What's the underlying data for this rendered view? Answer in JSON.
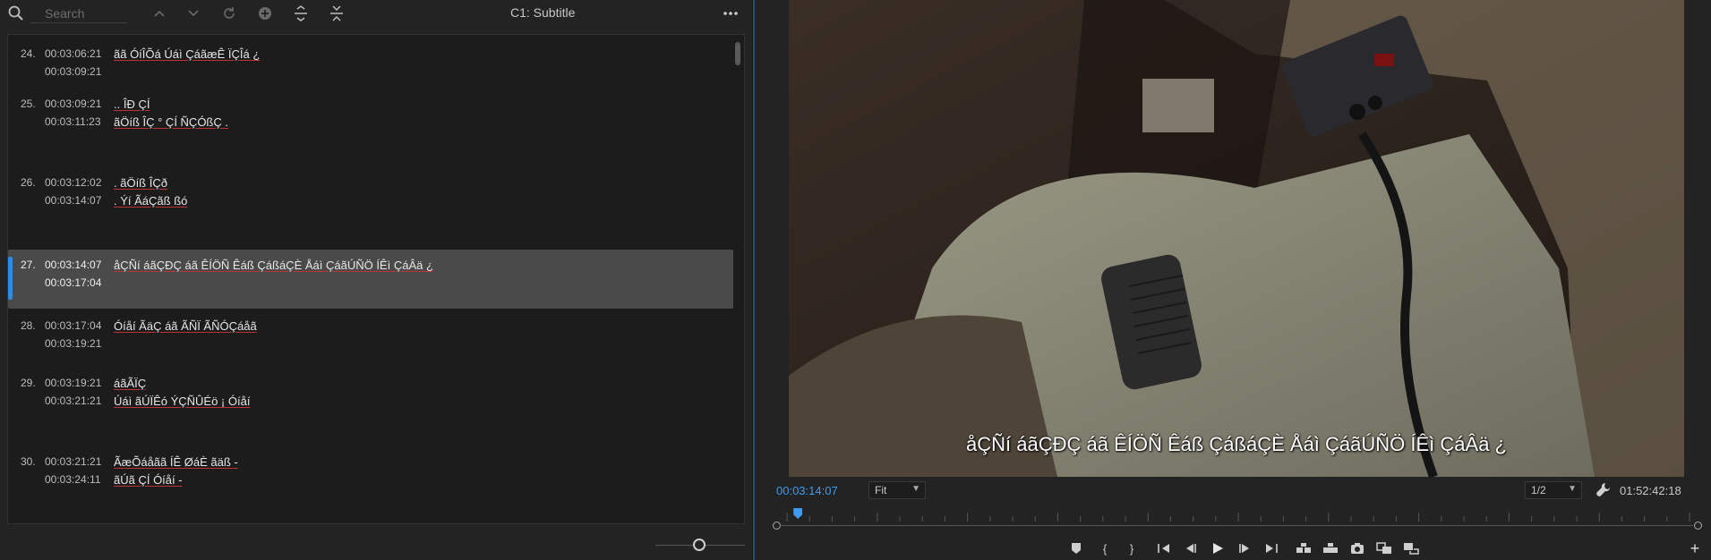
{
  "captions_panel": {
    "search": {
      "placeholder": "Search"
    },
    "title": "C1: Subtitle",
    "rows": [
      {
        "num": "24.",
        "in": "00:03:06:21",
        "out": "00:03:09:21",
        "lines": [
          "ãã ÓíÎÕá Úáì ÇáãæÊ ÏÇÎá ¿"
        ]
      },
      {
        "num": "25.",
        "in": "00:03:09:21",
        "out": "00:03:11:23",
        "lines": [
          ".. ÎÐ ÇÍ",
          "ãÖíß ÎÇ ° ÇÍ ÑÇÓßÇ ."
        ]
      },
      {
        "num": "26.",
        "in": "00:03:12:02",
        "out": "00:03:14:07",
        "lines": [
          ". ãÖíß ÎÇð",
          ". Ýí ÃáÇãß ßó"
        ]
      },
      {
        "num": "27.",
        "in": "00:03:14:07",
        "out": "00:03:17:04",
        "lines": [
          "åÇÑí áãÇÐÇ áã ÊÍÖÑ Êáß ÇáßáÇÈ Åáì ÇáãÚÑÖ ÍÊì ÇáÂä ¿"
        ],
        "selected": true
      },
      {
        "num": "28.",
        "in": "00:03:17:04",
        "out": "00:03:19:21",
        "lines": [
          "Óíåí ÃäÇ áã ÃÑÏ ÃÑÓÇáåã"
        ]
      },
      {
        "num": "29.",
        "in": "00:03:19:21",
        "out": "00:03:21:21",
        "lines": [
          "áãÃÏÇ",
          "Úáì ãÚÏÊó ÝÇÑÛÉö ¡ Óíåí"
        ]
      },
      {
        "num": "30.",
        "in": "00:03:21:21",
        "out": "00:03:24:11",
        "lines": [
          "ÃæÕáåãã ÍÊ ØáÈ ãäß -",
          "ãÚã ÇÍ Óíåí -"
        ]
      }
    ]
  },
  "monitor": {
    "subtitle_text": "åÇÑí áãÇÐÇ áã ÊÍÖÑ Êáß ÇáßáÇÈ Åáì ÇáãÚÑÖ ÍÊì ÇáÂä ¿",
    "current_timecode": "00:03:14:07",
    "fit_label": "Fit",
    "resolution_label": "1/2",
    "duration_timecode": "01:52:42:18",
    "playhead_progress": 0.013
  },
  "colors": {
    "accent": "#2d8ceb",
    "timecode": "#3d9bf0",
    "selected_row": "#4a4a4a",
    "panel_bg": "#232323"
  }
}
